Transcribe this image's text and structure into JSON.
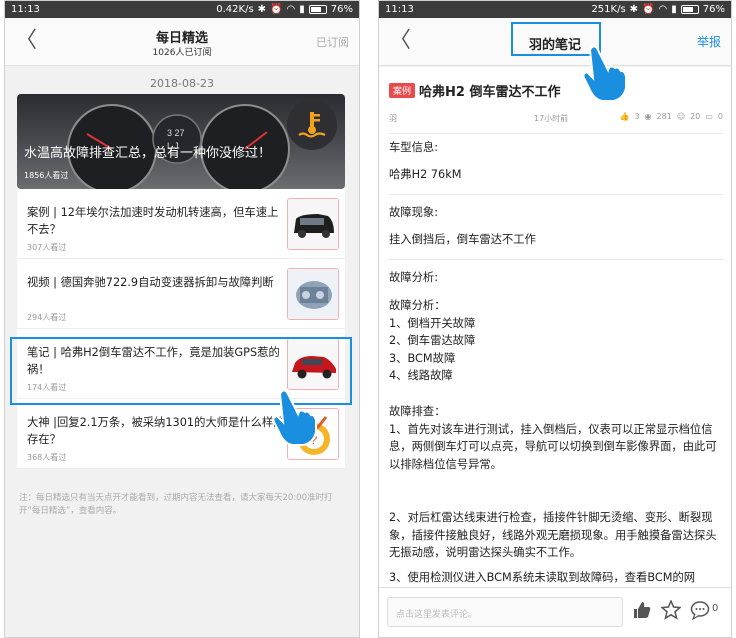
{
  "colors": {
    "accent": "#1a8fe0",
    "tag_red": "#e94b4b",
    "highlight_border": "#1a8fe0"
  },
  "left": {
    "status": {
      "time": "11:13",
      "speed": "0.42K/s",
      "battery": "76%",
      "battery_level": 0.76
    },
    "nav": {
      "title": "每日精选",
      "subtitle": "1026人已订阅",
      "action": "已订阅"
    },
    "date": "2018-08-23",
    "hero": {
      "title": "水温高故障排查汇总，总有一种你没修过！",
      "views": "1856人看过"
    },
    "cards": [
      {
        "title": "案例 | 12年埃尔法加速时发动机转速高，但车速上不去？",
        "views": "307人看过",
        "thumb_icon": "van-thumbnail"
      },
      {
        "title": "视频 | 德国奔驰722.9自动变速器拆卸与故障判断",
        "views": "294人看过",
        "thumb_icon": "transmission-thumbnail"
      },
      {
        "title": "笔记 | 哈弗H2倒车雷达不工作，竟是加装GPS惹的祸！",
        "views": "174人看过",
        "thumb_icon": "red-suv-thumbnail"
      },
      {
        "title": "大神 |回复2.1万条，被采纳1301的大师是什么样的存在？",
        "views": "368人看过",
        "thumb_icon": "medal-thumbnail"
      }
    ],
    "note": "注：每日精选只有当天点开才能看到，过期内容无法查看，请大家每天20:00准时打开“每日精选”，查看内容。"
  },
  "right": {
    "status": {
      "time": "11:13",
      "speed": "251K/s",
      "battery": "76%",
      "battery_level": 0.76
    },
    "nav": {
      "title": "羽的笔记",
      "action": "举报"
    },
    "article": {
      "tag": "案例",
      "title": "哈弗H2 倒车雷达不工作",
      "author": "羽",
      "time": "17小时前",
      "likes": "3",
      "views": "281",
      "followers": "20",
      "comments": "0",
      "sections": [
        {
          "lines": [
            "车型信息:",
            "哈弗H2 76kM"
          ]
        },
        {
          "lines": [
            "故障现象:",
            "挂入倒挡后，倒车雷达不工作"
          ]
        },
        {
          "lines": [
            "故障分析:"
          ]
        },
        {
          "lines": [
            "故障分析：",
            "1、倒档开关故障",
            "2、倒车雷达故障",
            "3、BCM故障",
            "4、线路故障"
          ]
        },
        {
          "lines": [
            "故障排查：",
            "1、首先对该车进行测试，挂入倒档后，仪表可以正常显示档位信息，两侧倒车灯可以点亮，导航可以切换到倒车影像界面，由此可以排除档位信号异常。"
          ]
        },
        {
          "lines": [
            "2、对后杠雷达线束进行检查，插接件针脚无烫缩、变形、断裂现象，插接件接触良好，线路外观无磨损现象。用手触摸备雷达探头无振动感，说明雷达探头确实不工作。"
          ]
        },
        {
          "lines": [
            "3、使用检测仪进入BCM系统未读取到故障码，查看BCM的网"
          ]
        }
      ]
    },
    "comment_placeholder": "点击这里发表评论。",
    "comment_count": "0"
  }
}
